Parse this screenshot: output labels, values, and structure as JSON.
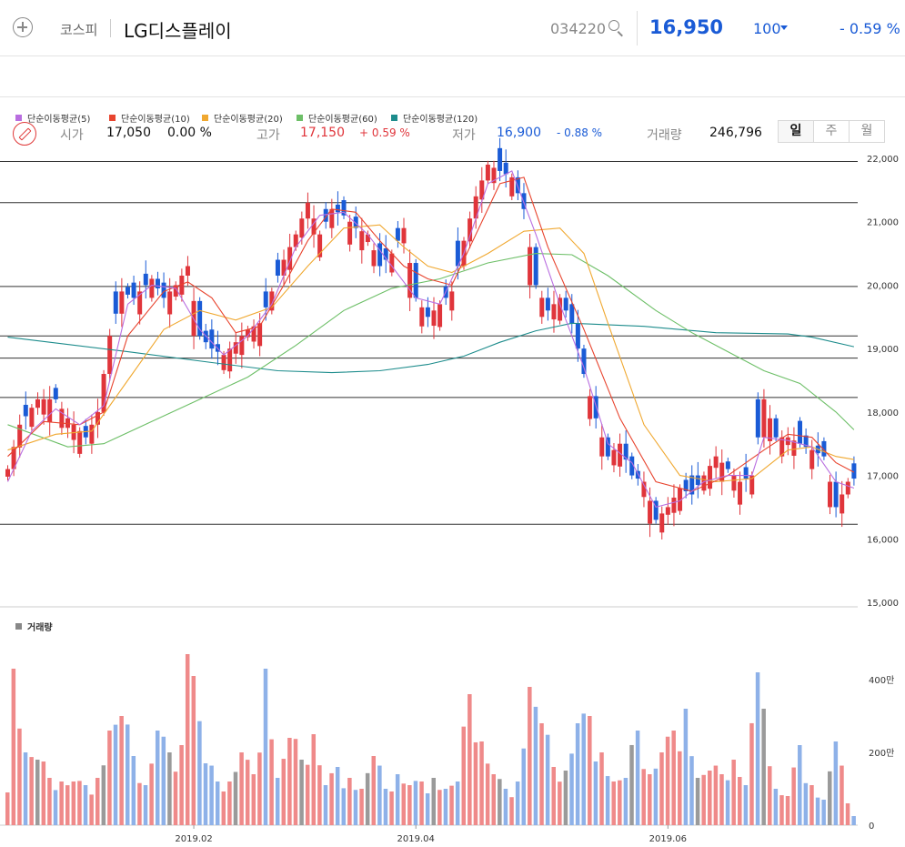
{
  "header": {
    "add_icon": "plus-circle-icon",
    "market": "코스피",
    "name": "LG디스플레이",
    "code": "034220",
    "search_icon": "search-icon",
    "price": "16,950",
    "change": "100",
    "change_direction": "down",
    "change_pct": "- 0.59 %"
  },
  "quote": {
    "edit_icon": "pencil-circle-icon",
    "open_label": "시가",
    "open": "17,050",
    "open_pct": "0.00 %",
    "high_label": "고가",
    "high": "17,150",
    "high_pct": "+ 0.59 %",
    "low_label": "저가",
    "low": "16,900",
    "low_pct": "- 0.88 %",
    "volume_label": "거래량",
    "volume": "246,796"
  },
  "periods": [
    {
      "label": "일",
      "active": true
    },
    {
      "label": "주",
      "active": false
    },
    {
      "label": "월",
      "active": false
    }
  ],
  "colors": {
    "up": "#e0353b",
    "down": "#1a5bd6",
    "up_vol": "#ef8a8a",
    "down_vol": "#8eb1e8",
    "flat_vol": "#9a9a9a"
  },
  "chart_data": {
    "type": "candlestick",
    "legend": [
      {
        "name": "단순이동평균(5)",
        "color": "#b96ee0"
      },
      {
        "name": "단순이동평균(10)",
        "color": "#e8442e"
      },
      {
        "name": "단순이동평균(20)",
        "color": "#f0a830"
      },
      {
        "name": "단순이동평균(60)",
        "color": "#6dbf67"
      },
      {
        "name": "단순이동평균(120)",
        "color": "#1d8c8c"
      }
    ],
    "y_ticks": [
      "22,000",
      "21,000",
      "20,000",
      "19,000",
      "18,000",
      "17,000",
      "16,000",
      "15,000"
    ],
    "y_tick_values": [
      22000,
      21000,
      20000,
      19000,
      18000,
      17000,
      16000,
      15000
    ],
    "ylim": [
      15000,
      22300
    ],
    "h_lines": [
      21950,
      21300,
      19980,
      19200,
      18850,
      18230,
      16230
    ],
    "x_ticks": [
      {
        "label": "2019.02",
        "index": 31
      },
      {
        "label": "2019.04",
        "index": 68
      },
      {
        "label": "2019.06",
        "index": 110
      }
    ],
    "volume_label": "거래량",
    "volume_ticks": [
      "400만",
      "200만",
      "0"
    ],
    "volume_tick_values": [
      400,
      200,
      0
    ],
    "volume_unit": "만",
    "volume_max": 500,
    "anchors": [
      [
        0,
        17100,
        1
      ],
      [
        2,
        17800,
        1
      ],
      [
        5,
        18200,
        1
      ],
      [
        8,
        18200,
        -1
      ],
      [
        10,
        17900,
        1
      ],
      [
        13,
        17600,
        -1
      ],
      [
        15,
        18000,
        1
      ],
      [
        17,
        19200,
        1
      ],
      [
        19,
        19900,
        1
      ],
      [
        21,
        19800,
        -1
      ],
      [
        24,
        20100,
        1
      ],
      [
        26,
        19800,
        -1
      ],
      [
        28,
        20000,
        1
      ],
      [
        30,
        20300,
        1
      ],
      [
        32,
        19200,
        -1
      ],
      [
        34,
        19000,
        -1
      ],
      [
        36,
        18900,
        1
      ],
      [
        38,
        19100,
        1
      ],
      [
        40,
        19300,
        1
      ],
      [
        42,
        19400,
        1
      ],
      [
        44,
        19900,
        1
      ],
      [
        46,
        20400,
        1
      ],
      [
        48,
        20800,
        1
      ],
      [
        50,
        21300,
        1
      ],
      [
        52,
        20800,
        1
      ],
      [
        54,
        21200,
        1
      ],
      [
        56,
        21100,
        -1
      ],
      [
        58,
        20900,
        -1
      ],
      [
        60,
        20800,
        1
      ],
      [
        62,
        20300,
        -1
      ],
      [
        64,
        20500,
        1
      ],
      [
        66,
        20900,
        1
      ],
      [
        68,
        19800,
        -1
      ],
      [
        70,
        19500,
        -1
      ],
      [
        72,
        19700,
        1
      ],
      [
        74,
        19900,
        1
      ],
      [
        76,
        20700,
        1
      ],
      [
        78,
        21400,
        1
      ],
      [
        80,
        21900,
        1
      ],
      [
        82,
        21800,
        -1
      ],
      [
        84,
        21700,
        1
      ],
      [
        86,
        21200,
        -1
      ],
      [
        88,
        20000,
        -1
      ],
      [
        90,
        19600,
        -1
      ],
      [
        92,
        19800,
        1
      ],
      [
        94,
        19400,
        -1
      ],
      [
        96,
        18600,
        -1
      ],
      [
        98,
        17900,
        -1
      ],
      [
        100,
        17300,
        -1
      ],
      [
        102,
        17500,
        1
      ],
      [
        104,
        17000,
        -1
      ],
      [
        106,
        16900,
        1
      ],
      [
        108,
        16300,
        -1
      ],
      [
        110,
        16500,
        1
      ],
      [
        112,
        16800,
        1
      ],
      [
        114,
        16700,
        -1
      ],
      [
        116,
        17000,
        1
      ],
      [
        118,
        17300,
        1
      ],
      [
        120,
        17100,
        -1
      ],
      [
        122,
        16900,
        1
      ],
      [
        124,
        17000,
        1
      ],
      [
        126,
        18200,
        1
      ],
      [
        128,
        17600,
        -1
      ],
      [
        130,
        17600,
        1
      ],
      [
        132,
        17500,
        -1
      ],
      [
        134,
        17400,
        1
      ],
      [
        136,
        17300,
        -1
      ],
      [
        138,
        16500,
        -1
      ],
      [
        140,
        16900,
        1
      ],
      [
        141,
        16950,
        -1
      ]
    ],
    "volume_anchors": [
      [
        0,
        90
      ],
      [
        1,
        430
      ],
      [
        3,
        200
      ],
      [
        5,
        180
      ],
      [
        7,
        130
      ],
      [
        9,
        120
      ],
      [
        11,
        120
      ],
      [
        13,
        110
      ],
      [
        15,
        130
      ],
      [
        17,
        260
      ],
      [
        19,
        300
      ],
      [
        21,
        190
      ],
      [
        23,
        110
      ],
      [
        25,
        260
      ],
      [
        27,
        200
      ],
      [
        29,
        220
      ],
      [
        30,
        470
      ],
      [
        31,
        410
      ],
      [
        33,
        170
      ],
      [
        35,
        120
      ],
      [
        37,
        120
      ],
      [
        39,
        200
      ],
      [
        41,
        140
      ],
      [
        43,
        430
      ],
      [
        45,
        130
      ],
      [
        47,
        240
      ],
      [
        49,
        180
      ],
      [
        51,
        250
      ],
      [
        53,
        110
      ],
      [
        55,
        160
      ],
      [
        57,
        130
      ],
      [
        59,
        100
      ],
      [
        61,
        190
      ],
      [
        63,
        100
      ],
      [
        65,
        140
      ],
      [
        67,
        110
      ],
      [
        69,
        120
      ],
      [
        71,
        130
      ],
      [
        73,
        100
      ],
      [
        75,
        120
      ],
      [
        77,
        360
      ],
      [
        79,
        230
      ],
      [
        81,
        140
      ],
      [
        83,
        100
      ],
      [
        85,
        120
      ],
      [
        87,
        380
      ],
      [
        89,
        280
      ],
      [
        91,
        160
      ],
      [
        93,
        150
      ],
      [
        95,
        280
      ],
      [
        97,
        300
      ],
      [
        99,
        200
      ],
      [
        101,
        120
      ],
      [
        103,
        130
      ],
      [
        105,
        260
      ],
      [
        107,
        140
      ],
      [
        109,
        200
      ],
      [
        111,
        260
      ],
      [
        113,
        320
      ],
      [
        115,
        130
      ],
      [
        117,
        150
      ],
      [
        119,
        140
      ],
      [
        121,
        180
      ],
      [
        123,
        110
      ],
      [
        125,
        420
      ],
      [
        126,
        320
      ],
      [
        128,
        100
      ],
      [
        130,
        80
      ],
      [
        132,
        220
      ],
      [
        134,
        110
      ],
      [
        136,
        70
      ],
      [
        138,
        230
      ],
      [
        140,
        60
      ],
      [
        141,
        25
      ]
    ],
    "ma_values": {
      "ma120": [
        [
          0,
          19180
        ],
        [
          20,
          18950
        ],
        [
          34,
          18780
        ],
        [
          45,
          18650
        ],
        [
          54,
          18620
        ],
        [
          62,
          18650
        ],
        [
          70,
          18750
        ],
        [
          76,
          18880
        ],
        [
          82,
          19100
        ],
        [
          88,
          19280
        ],
        [
          94,
          19400
        ],
        [
          106,
          19350
        ],
        [
          118,
          19250
        ],
        [
          130,
          19230
        ],
        [
          134,
          19180
        ],
        [
          141,
          19030
        ]
      ],
      "ma60": [
        [
          0,
          17800
        ],
        [
          10,
          17450
        ],
        [
          16,
          17500
        ],
        [
          24,
          17850
        ],
        [
          32,
          18200
        ],
        [
          40,
          18550
        ],
        [
          48,
          19050
        ],
        [
          56,
          19600
        ],
        [
          64,
          19950
        ],
        [
          72,
          20100
        ],
        [
          80,
          20350
        ],
        [
          88,
          20500
        ],
        [
          94,
          20480
        ],
        [
          100,
          20150
        ],
        [
          108,
          19600
        ],
        [
          114,
          19250
        ],
        [
          120,
          18950
        ],
        [
          126,
          18650
        ],
        [
          132,
          18450
        ],
        [
          138,
          18000
        ],
        [
          141,
          17720
        ]
      ],
      "ma20": [
        [
          0,
          17400
        ],
        [
          8,
          17650
        ],
        [
          14,
          17700
        ],
        [
          20,
          18500
        ],
        [
          26,
          19300
        ],
        [
          32,
          19600
        ],
        [
          38,
          19450
        ],
        [
          44,
          19650
        ],
        [
          50,
          20300
        ],
        [
          56,
          20900
        ],
        [
          62,
          20950
        ],
        [
          66,
          20600
        ],
        [
          70,
          20300
        ],
        [
          74,
          20200
        ],
        [
          80,
          20500
        ],
        [
          86,
          20850
        ],
        [
          92,
          20900
        ],
        [
          96,
          20500
        ],
        [
          100,
          19400
        ],
        [
          106,
          17800
        ],
        [
          112,
          17000
        ],
        [
          118,
          16900
        ],
        [
          124,
          16950
        ],
        [
          130,
          17400
        ],
        [
          134,
          17450
        ],
        [
          138,
          17300
        ],
        [
          141,
          17250
        ]
      ],
      "ma10": [
        [
          0,
          17300
        ],
        [
          6,
          17850
        ],
        [
          12,
          17800
        ],
        [
          16,
          18000
        ],
        [
          20,
          19200
        ],
        [
          26,
          19900
        ],
        [
          30,
          20050
        ],
        [
          34,
          19800
        ],
        [
          38,
          19250
        ],
        [
          42,
          19350
        ],
        [
          46,
          20000
        ],
        [
          50,
          20700
        ],
        [
          54,
          21200
        ],
        [
          58,
          21150
        ],
        [
          62,
          20700
        ],
        [
          66,
          20300
        ],
        [
          70,
          20100
        ],
        [
          74,
          20000
        ],
        [
          78,
          20800
        ],
        [
          82,
          21600
        ],
        [
          86,
          21700
        ],
        [
          90,
          20600
        ],
        [
          96,
          19300
        ],
        [
          102,
          17900
        ],
        [
          108,
          16900
        ],
        [
          114,
          16750
        ],
        [
          120,
          17000
        ],
        [
          126,
          17400
        ],
        [
          130,
          17650
        ],
        [
          134,
          17600
        ],
        [
          138,
          17200
        ],
        [
          141,
          17050
        ]
      ],
      "ma5": [
        [
          0,
          16900
        ],
        [
          4,
          17700
        ],
        [
          8,
          18050
        ],
        [
          12,
          17800
        ],
        [
          16,
          18100
        ],
        [
          20,
          19700
        ],
        [
          24,
          20000
        ],
        [
          28,
          19950
        ],
        [
          32,
          19300
        ],
        [
          36,
          18900
        ],
        [
          40,
          19200
        ],
        [
          44,
          19700
        ],
        [
          48,
          20600
        ],
        [
          52,
          21100
        ],
        [
          56,
          21150
        ],
        [
          60,
          20800
        ],
        [
          64,
          20300
        ],
        [
          68,
          19800
        ],
        [
          72,
          19700
        ],
        [
          76,
          20500
        ],
        [
          80,
          21600
        ],
        [
          84,
          21800
        ],
        [
          88,
          20800
        ],
        [
          92,
          19700
        ],
        [
          96,
          18700
        ],
        [
          100,
          17500
        ],
        [
          104,
          17200
        ],
        [
          108,
          16500
        ],
        [
          112,
          16600
        ],
        [
          116,
          16900
        ],
        [
          120,
          17000
        ],
        [
          124,
          17000
        ],
        [
          126,
          17600
        ],
        [
          130,
          17550
        ],
        [
          134,
          17450
        ],
        [
          138,
          16900
        ],
        [
          141,
          16800
        ]
      ]
    },
    "n": 142
  }
}
